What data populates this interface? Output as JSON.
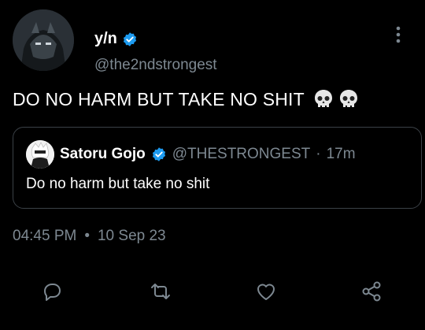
{
  "author": {
    "display_name": "y/n",
    "handle": "@the2ndstrongest",
    "verified": true
  },
  "tweet": {
    "text": "DO NO HARM BUT TAKE NO SHIT",
    "emoji": [
      "skull",
      "skull"
    ]
  },
  "quoted_tweet": {
    "display_name": "Satoru Gojo",
    "handle": "@THESTRONGEST",
    "separator": "·",
    "time_ago": "17m",
    "text": "Do no harm but take no shit"
  },
  "meta": {
    "time": "04:45 PM",
    "separator": "•",
    "date": "10 Sep 23"
  },
  "actions": [
    "reply-icon",
    "retweet-icon",
    "like-icon",
    "share-icon"
  ],
  "colors": {
    "background": "#000000",
    "text": "#ffffff",
    "secondary": "#7d8891",
    "verified": "#1d9bf0",
    "border": "#3b4147"
  }
}
